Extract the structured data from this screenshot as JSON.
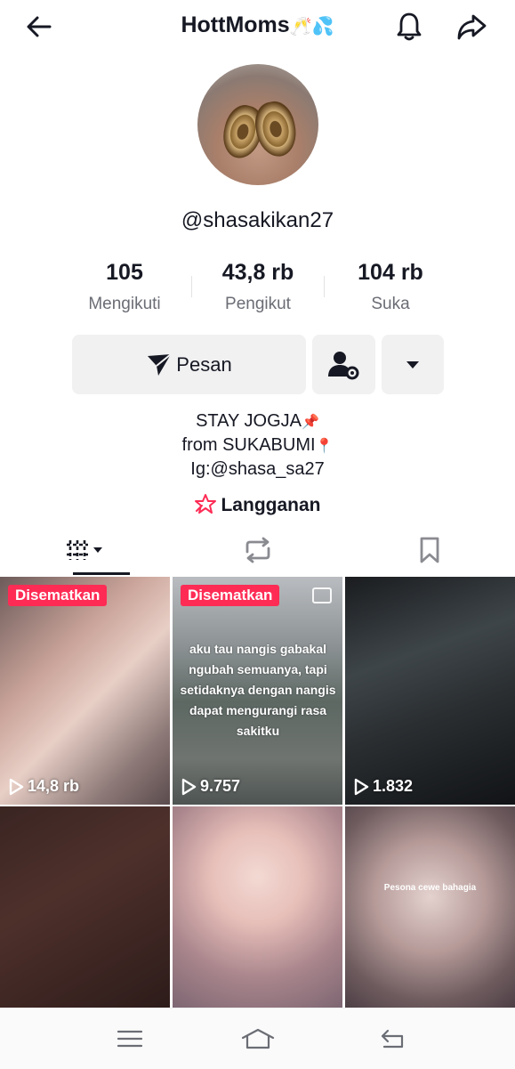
{
  "header": {
    "title": "HottMoms",
    "title_emoji": "🥂💦",
    "back_icon": "arrow-left-icon",
    "bell_icon": "bell-icon",
    "share_icon": "share-icon"
  },
  "profile": {
    "username": "@shasakikan27",
    "stats": [
      {
        "value": "105",
        "label": "Mengikuti"
      },
      {
        "value": "43,8 rb",
        "label": "Pengikut"
      },
      {
        "value": "104 rb",
        "label": "Suka"
      }
    ],
    "message_button": "Pesan",
    "bio_lines": [
      {
        "text": "STAY JOGJA",
        "emoji": "📌"
      },
      {
        "text": "from SUKABUMI",
        "emoji": "📍"
      },
      {
        "text": "Ig:@shasa_sa27",
        "emoji": ""
      }
    ],
    "subscribe_label": "Langganan"
  },
  "tabs": {
    "active": "videos",
    "icons": [
      "grid-icon",
      "repost-icon",
      "bookmark-icon"
    ]
  },
  "videos": [
    {
      "pinned_label": "Disematkan",
      "views": "14,8 rb",
      "overlay": ""
    },
    {
      "pinned_label": "Disematkan",
      "views": "9.757",
      "overlay": "aku tau nangis gabakal ngubah semuanya, tapi setidaknya dengan nangis dapat mengurangi rasa sakitku"
    },
    {
      "pinned_label": "",
      "views": "1.832",
      "overlay": ""
    },
    {
      "pinned_label": "",
      "views": "",
      "overlay": ""
    },
    {
      "pinned_label": "",
      "views": "",
      "overlay": ""
    },
    {
      "pinned_label": "",
      "views": "",
      "overlay": "Pesona cewe bahagia"
    }
  ],
  "colors": {
    "accent": "#fe2c55",
    "text": "#161823",
    "muted": "#6b6d75",
    "button_bg": "#f1f1f2"
  }
}
